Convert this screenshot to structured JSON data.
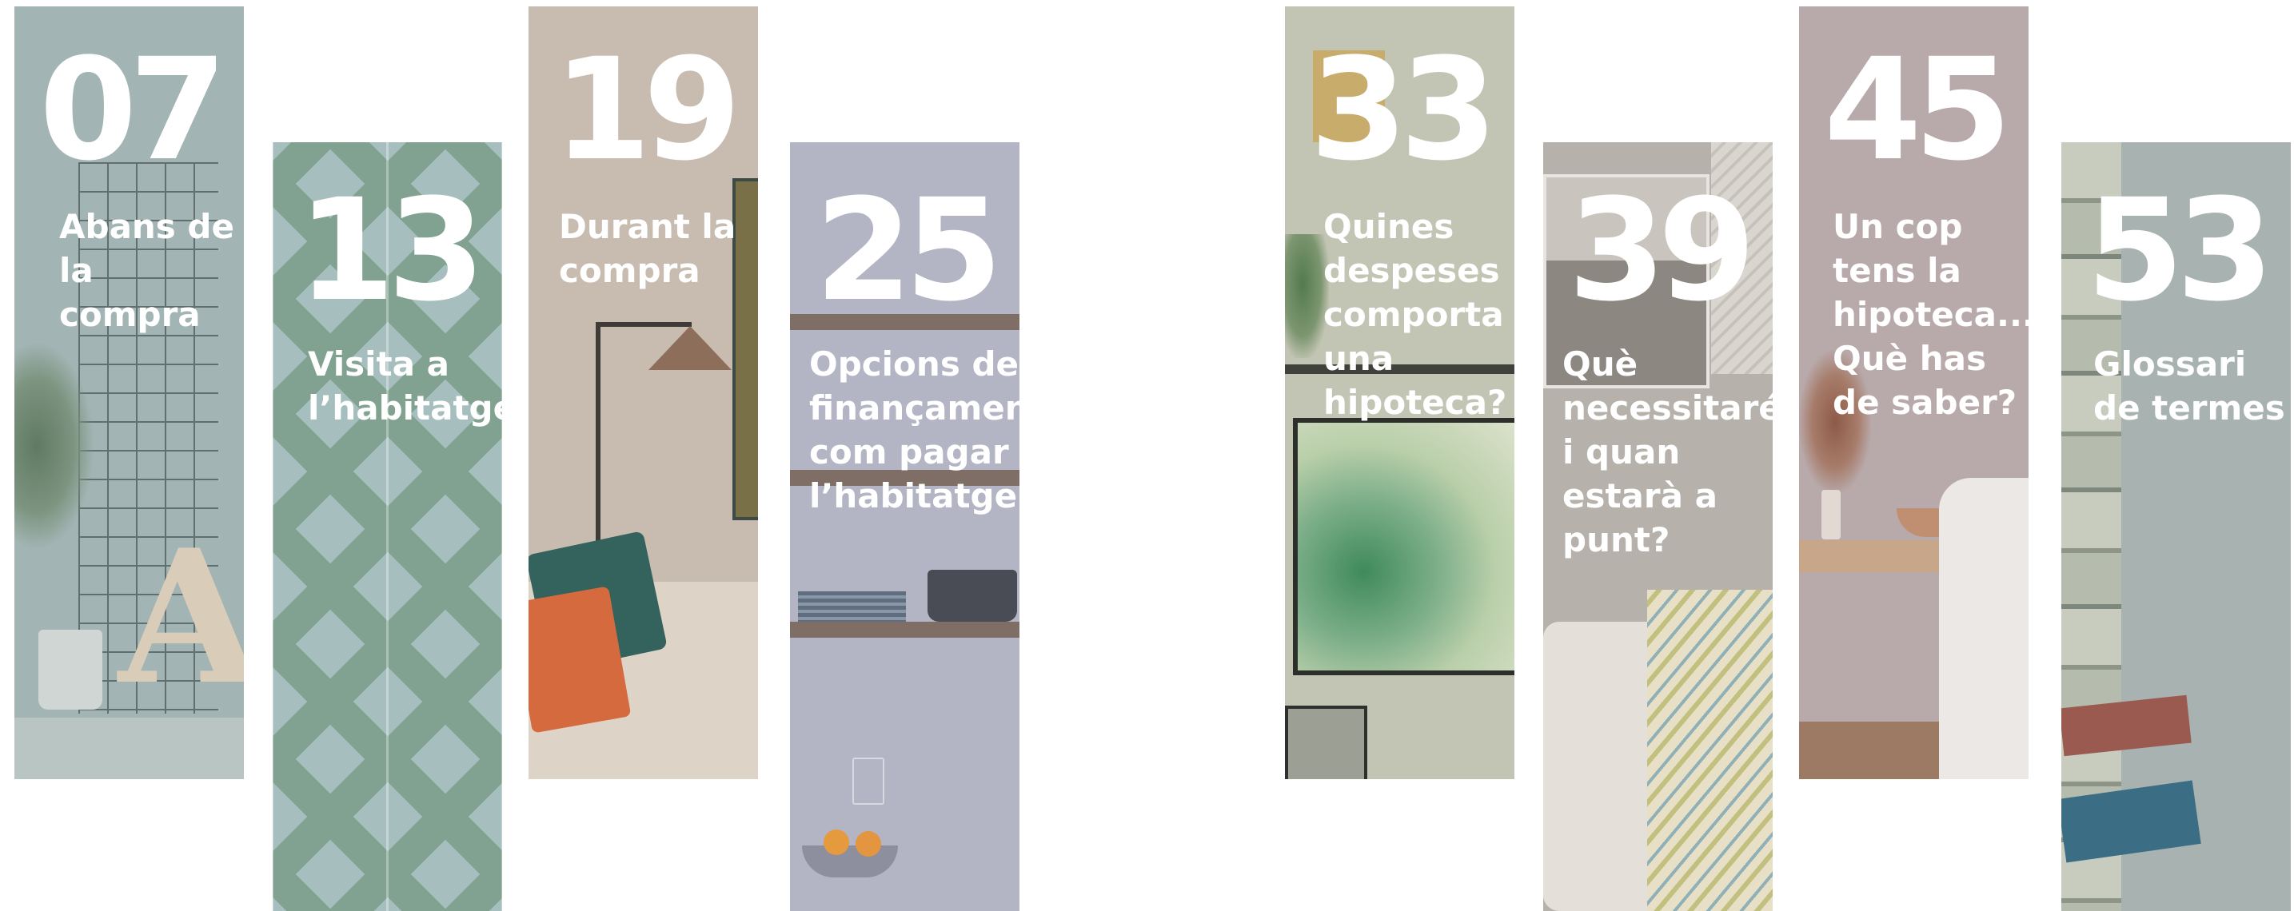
{
  "chapters": [
    {
      "number": "07",
      "title": "Abans de\nla compra"
    },
    {
      "number": "13",
      "title": "Visita a\nl’habitatge"
    },
    {
      "number": "19",
      "title": "Durant la\ncompra"
    },
    {
      "number": "25",
      "title": "Opcions de\nfinançament:\ncom pagar\nl’habitatge"
    },
    {
      "number": "33",
      "title": "Quines\ndespeses\ncomporta\nuna\nhipoteca?"
    },
    {
      "number": "39",
      "title": "Què\nnecessitaré\ni quan\nestarà a\npunt?"
    },
    {
      "number": "45",
      "title": "Un cop\ntens la\nhipoteca...\nQuè has\nde saber?"
    },
    {
      "number": "53",
      "title": "Glossari\nde termes"
    }
  ],
  "colors": {
    "p1": "#a2b4b3",
    "p2": "#a6bfbe",
    "p3": "#c8bcb1",
    "p4": "#b3b4c4",
    "p5": "#c3c5b4",
    "p6": "#b6b1ab",
    "p7": "#b8a9aa",
    "p8": "#a8b2b0",
    "tile_green": "#6e9378",
    "text": "#ffffff"
  }
}
